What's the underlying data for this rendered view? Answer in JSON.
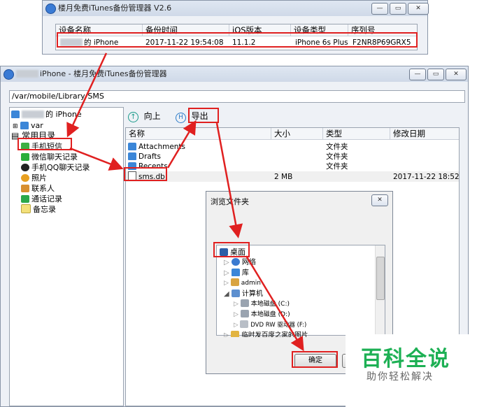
{
  "top_window": {
    "title": "楼月免费iTunes备份管理器 V2.6",
    "columns": [
      "设备名称",
      "备份时间",
      "iOS版本",
      "设备类型",
      "序列号"
    ],
    "row": {
      "device_name": "的 iPhone",
      "backup_time": "2017-11-22 19:54:08",
      "ios_version": "11.1.2",
      "device_type": "iPhone 6s Plus",
      "serial": "F2NR8P69GRX5"
    }
  },
  "main_window": {
    "title": "iPhone - 楼月免费iTunes备份管理器",
    "path": "/var/mobile/Library/SMS",
    "tree": {
      "root": "的 iPhone",
      "var": "var",
      "common": "常用目录",
      "items": [
        "手机短信",
        "微信聊天记录",
        "手机QQ聊天记录",
        "照片",
        "联系人",
        "通话记录",
        "备忘录"
      ]
    },
    "toolbar": {
      "up": "向上",
      "export": "导出"
    },
    "file_columns": [
      "名称",
      "大小",
      "类型",
      "修改日期"
    ],
    "files": [
      {
        "name": "Attachments",
        "size": "",
        "type": "文件夹",
        "date": ""
      },
      {
        "name": "Drafts",
        "size": "",
        "type": "文件夹",
        "date": ""
      },
      {
        "name": "Recents",
        "size": "",
        "type": "文件夹",
        "date": ""
      },
      {
        "name": "sms.db",
        "size": "2 MB",
        "type": "",
        "date": "2017-11-22 18:52"
      }
    ]
  },
  "dialog": {
    "title": "浏览文件夹",
    "tree": [
      "桌面",
      "网络",
      "库",
      "admin",
      "计算机",
      "本地磁盘 (C:)",
      "本地磁盘 (D:)",
      "DVD RW 驱动器 (F:)",
      "临时发百度之家的图片"
    ],
    "ok": "确定"
  },
  "watermark": {
    "title": "百科全说",
    "subtitle": "助你轻松解决"
  },
  "colors": {
    "highlight": "#e02020",
    "watermark": "#1db054"
  }
}
